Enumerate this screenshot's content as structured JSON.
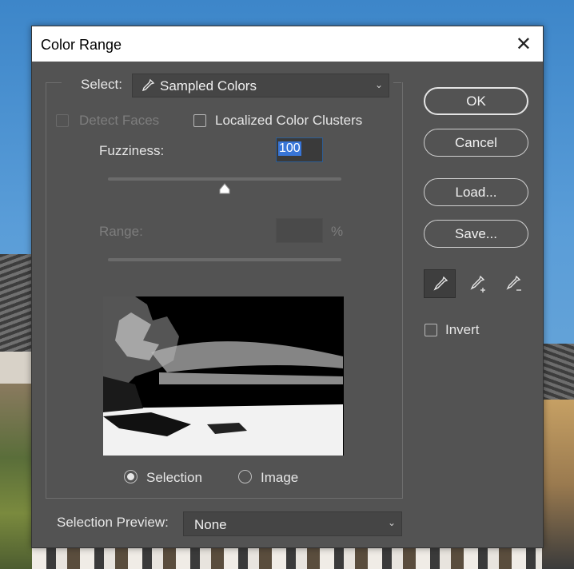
{
  "dialog": {
    "title": "Color Range",
    "select_label": "Select:",
    "select_value": "Sampled Colors",
    "detect_faces_label": "Detect Faces",
    "localized_label": "Localized Color Clusters",
    "fuzziness_label": "Fuzziness:",
    "fuzziness_value": "100",
    "fuzziness_level_percent": 50,
    "range_label": "Range:",
    "range_value": "",
    "range_unit": "%",
    "view_options": {
      "selection_label": "Selection",
      "image_label": "Image",
      "selected": "Selection"
    },
    "selection_preview_label": "Selection Preview:",
    "selection_preview_value": "None",
    "buttons": {
      "ok": "OK",
      "cancel": "Cancel",
      "load": "Load...",
      "save": "Save..."
    },
    "invert_label": "Invert",
    "eyedroppers": [
      "eyedropper-icon",
      "eyedropper-plus-icon",
      "eyedropper-minus-icon"
    ],
    "checkboxes": {
      "detect_faces": false,
      "localized": false,
      "invert": false
    }
  },
  "colors": {
    "panel": "#535353",
    "text": "#e6e6e6",
    "disabled_text": "#7d7d7d",
    "highlight": "#3875d7"
  }
}
